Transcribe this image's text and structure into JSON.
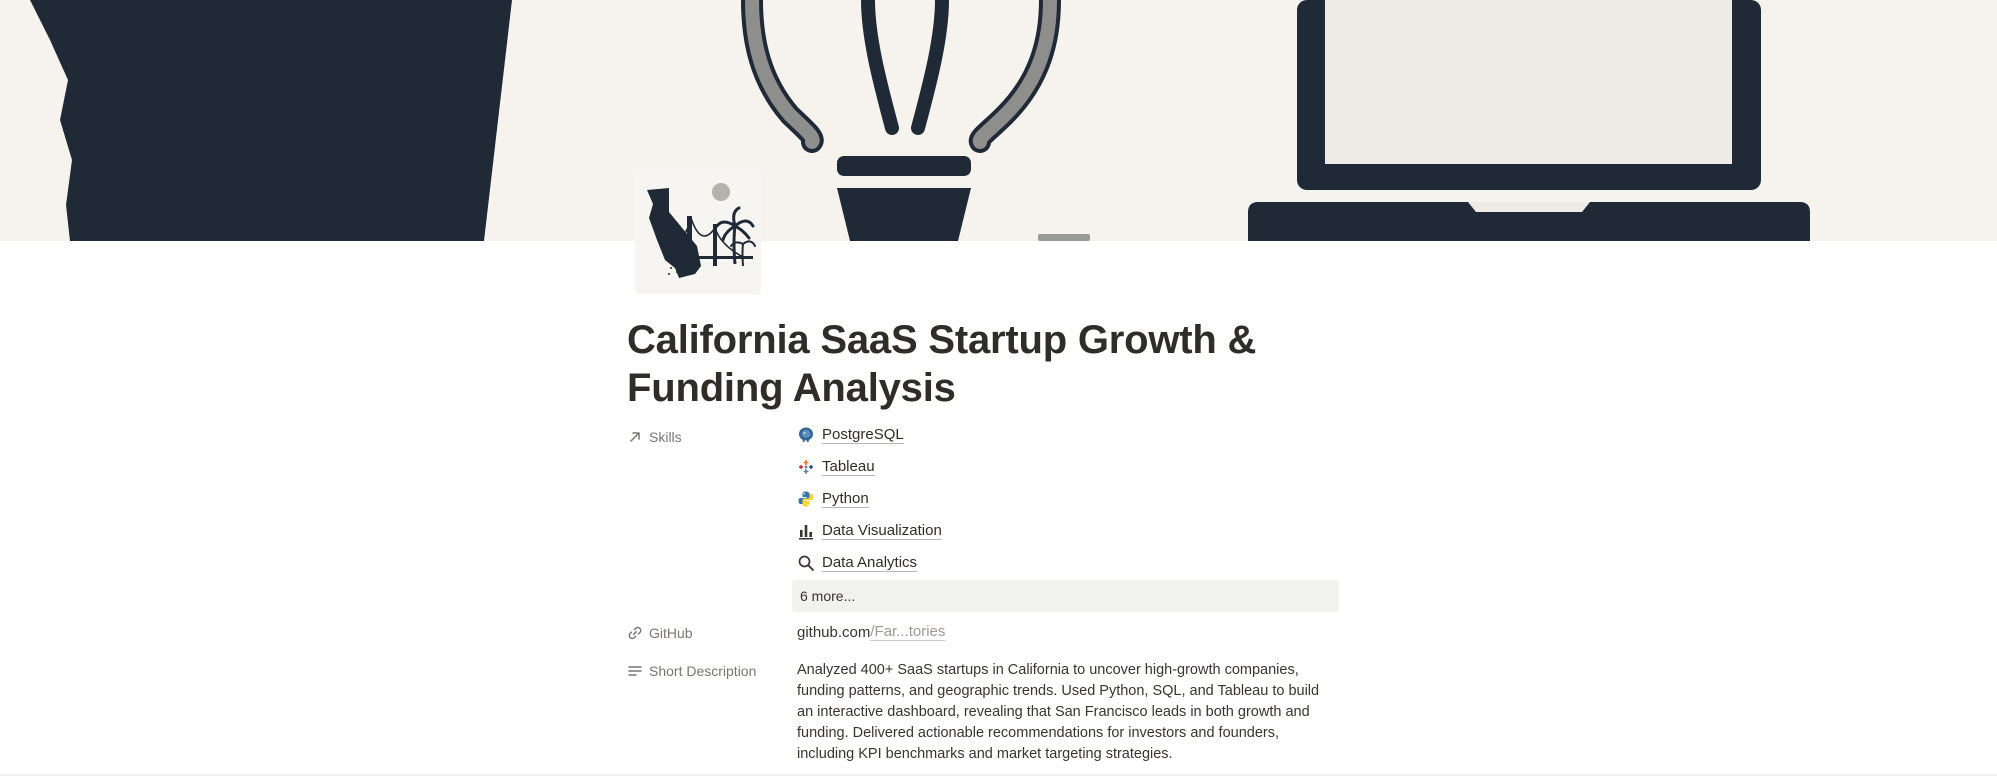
{
  "page": {
    "title": "California SaaS Startup Growth & Funding Analysis"
  },
  "cover": {
    "description_icons": [
      "california-silhouette",
      "lightbulb-icon",
      "laptop-icon"
    ]
  },
  "page_icon": "california-golden-gate-icon",
  "properties": {
    "skills": {
      "label": "Skills",
      "icon": "arrow-up-right-icon",
      "items": [
        {
          "label": "PostgreSQL",
          "icon": "postgresql-icon"
        },
        {
          "label": "Tableau",
          "icon": "tableau-icon"
        },
        {
          "label": "Python",
          "icon": "python-icon"
        },
        {
          "label": "Data Visualization",
          "icon": "bar-chart-icon"
        },
        {
          "label": "Data Analytics",
          "icon": "magnifier-icon"
        }
      ],
      "more_label": "6 more..."
    },
    "github": {
      "label": "GitHub",
      "icon": "link-icon",
      "value_main": "github.com",
      "value_dim": "/Far...tories"
    },
    "short_description": {
      "label": "Short Description",
      "icon": "text-lines-icon",
      "value": "Analyzed 400+ SaaS startups in California to uncover high-growth companies, funding patterns, and geographic trends. Used Python, SQL, and Tableau to build an interactive dashboard, revealing that San Francisco leads in both growth and funding. Delivered actionable recommendations for investors and founders, including KPI benchmarks and market targeting strategies."
    }
  },
  "colors": {
    "navy": "#1f2a36",
    "cover_bg": "#f6f3ee",
    "bulb_gray": "#8e8e8c",
    "text": "#37352f",
    "muted": "#787774"
  }
}
